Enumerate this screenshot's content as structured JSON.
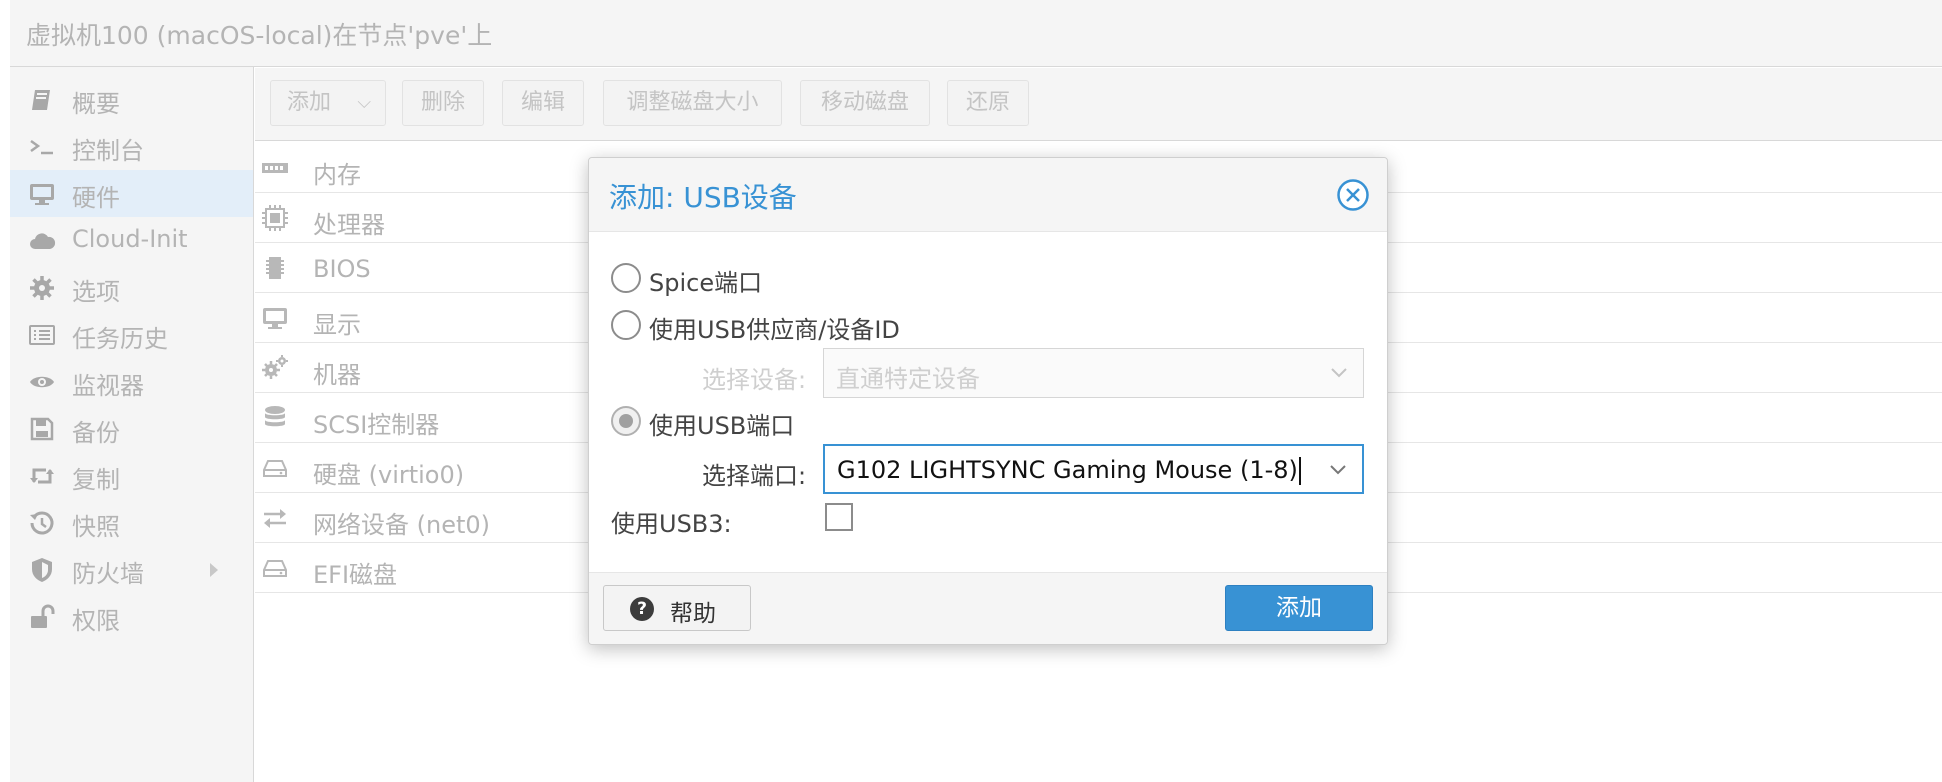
{
  "window": {
    "title": "虚拟机100 (macOS-local)在节点'pve'上"
  },
  "sidebar": {
    "items": [
      {
        "label": "概要",
        "icon": "book-icon"
      },
      {
        "label": "控制台",
        "icon": "terminal-icon"
      },
      {
        "label": "硬件",
        "icon": "monitor-icon",
        "selected": true
      },
      {
        "label": "Cloud-Init",
        "icon": "cloud-icon"
      },
      {
        "label": "选项",
        "icon": "gear-icon"
      },
      {
        "label": "任务历史",
        "icon": "list-icon"
      },
      {
        "label": "监视器",
        "icon": "eye-icon"
      },
      {
        "label": "备份",
        "icon": "floppy-icon"
      },
      {
        "label": "复制",
        "icon": "retweet-icon"
      },
      {
        "label": "快照",
        "icon": "history-icon"
      },
      {
        "label": "防火墙",
        "icon": "shield-icon",
        "has_submenu": true
      },
      {
        "label": "权限",
        "icon": "unlock-icon"
      }
    ]
  },
  "toolbar": {
    "add_label": "添加",
    "remove_label": "删除",
    "edit_label": "编辑",
    "resize_label": "调整磁盘大小",
    "move_label": "移动磁盘",
    "revert_label": "还原"
  },
  "hardware": {
    "rows": [
      {
        "label": "内存",
        "icon": "memory-icon"
      },
      {
        "label": "处理器",
        "icon": "cpu-icon"
      },
      {
        "label": "BIOS",
        "icon": "microchip-icon"
      },
      {
        "label": "显示",
        "icon": "desktop-icon"
      },
      {
        "label": "机器",
        "icon": "cogs-icon"
      },
      {
        "label": "SCSI控制器",
        "icon": "database-icon"
      },
      {
        "label": "硬盘 (virtio0)",
        "icon": "hdd-icon"
      },
      {
        "label": "网络设备 (net0)",
        "icon": "exchange-icon"
      },
      {
        "label": "EFI磁盘",
        "icon": "hdd-icon"
      }
    ]
  },
  "dialog": {
    "title": "添加: USB设备",
    "options": {
      "spice": "Spice端口",
      "vendor": "使用USB供应商/设备ID",
      "port": "使用USB端口"
    },
    "selected_option": "port",
    "device_label": "选择设备:",
    "device_value": "直通特定设备",
    "port_label": "选择端口:",
    "port_value": "G102 LIGHTSYNC Gaming Mouse (1-8)",
    "usb3_label": "使用USB3:",
    "usb3_checked": false,
    "help_label": "帮助",
    "add_label": "添加"
  },
  "colors": {
    "accent": "#3892d4",
    "selected_nav": "#e3eef9",
    "panel_bg": "#f5f5f5"
  }
}
